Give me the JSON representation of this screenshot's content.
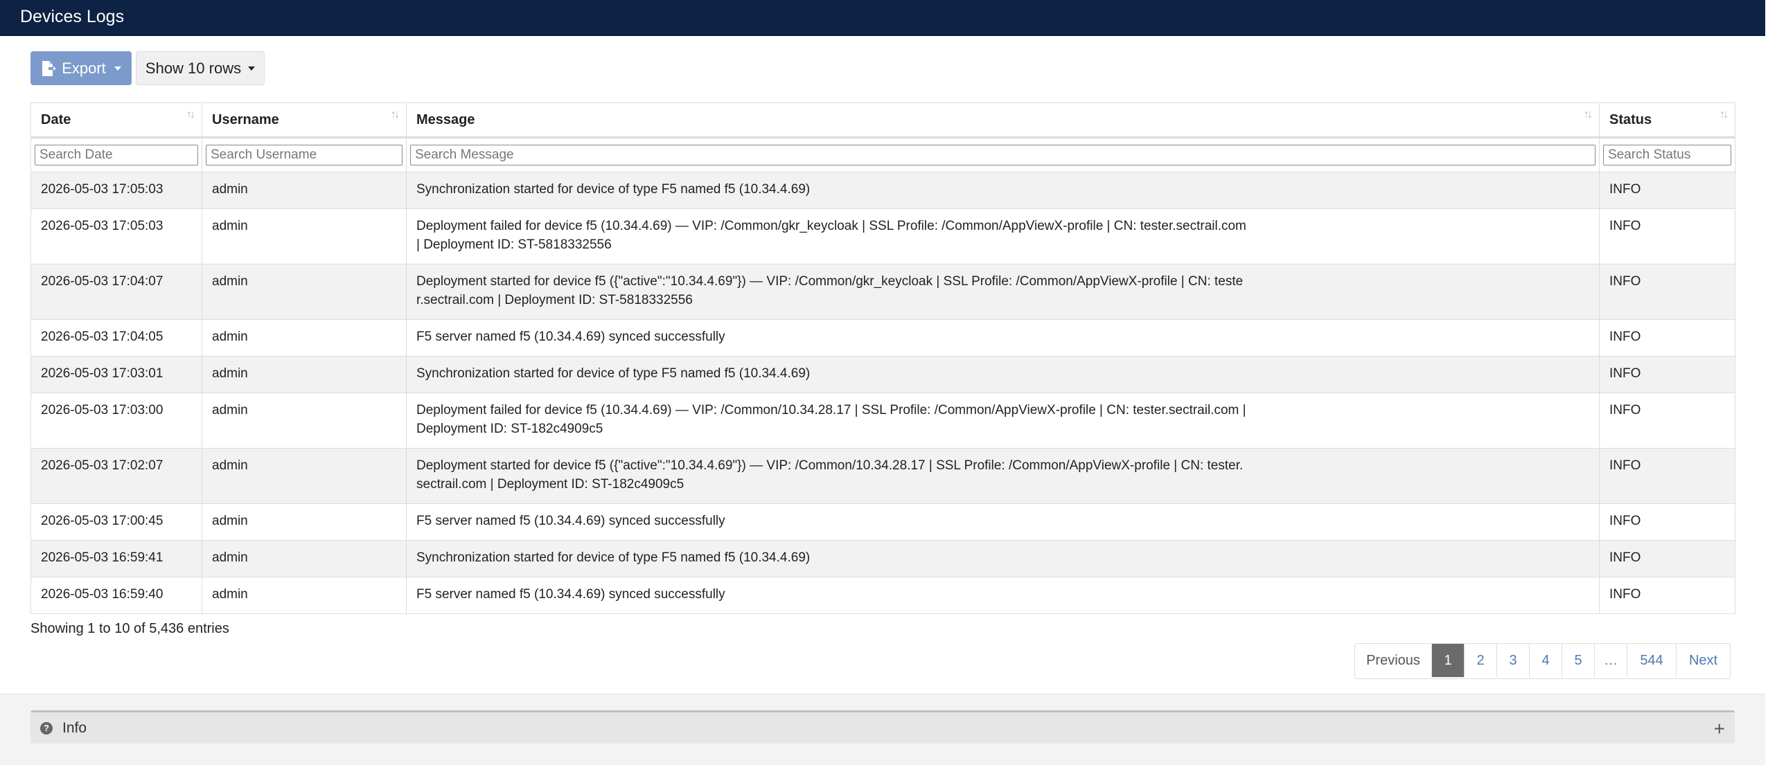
{
  "window": {
    "title": "Devices Logs"
  },
  "toolbar": {
    "export_label": "Export",
    "rows_label": "Show 10 rows"
  },
  "table": {
    "columns": [
      "Date",
      "Username",
      "Message",
      "Status"
    ],
    "filter_placeholders": [
      "Search Date",
      "Search Username",
      "Search Message",
      "Search Status"
    ],
    "rows": [
      {
        "date": "2026-05-03 17:05:03",
        "user": "admin",
        "message": "Synchronization started for device of type F5 named f5 (10.34.4.69)",
        "status": "INFO"
      },
      {
        "date": "2026-05-03 17:05:03",
        "user": "admin",
        "message": "Deployment failed for device f5 (10.34.4.69) — VIP: /Common/gkr_keycloak | SSL Profile: /Common/AppViewX-profile | CN: tester.sectrail.com | Deployment ID: ST-5818332556",
        "status": "INFO"
      },
      {
        "date": "2026-05-03 17:04:07",
        "user": "admin",
        "message": "Deployment started for device f5 ({\"active\":\"10.34.4.69\"}) — VIP: /Common/gkr_keycloak | SSL Profile: /Common/AppViewX-profile | CN: tester.sectrail.com | Deployment ID: ST-5818332556",
        "status": "INFO"
      },
      {
        "date": "2026-05-03 17:04:05",
        "user": "admin",
        "message": "F5 server named f5 (10.34.4.69) synced successfully",
        "status": "INFO"
      },
      {
        "date": "2026-05-03 17:03:01",
        "user": "admin",
        "message": "Synchronization started for device of type F5 named f5 (10.34.4.69)",
        "status": "INFO"
      },
      {
        "date": "2026-05-03 17:03:00",
        "user": "admin",
        "message": "Deployment failed for device f5 (10.34.4.69) — VIP: /Common/10.34.28.17 | SSL Profile: /Common/AppViewX-profile | CN: tester.sectrail.com | Deployment ID: ST-182c4909c5",
        "status": "INFO"
      },
      {
        "date": "2026-05-03 17:02:07",
        "user": "admin",
        "message": "Deployment started for device f5 ({\"active\":\"10.34.4.69\"}) — VIP: /Common/10.34.28.17 | SSL Profile: /Common/AppViewX-profile | CN: tester.sectrail.com | Deployment ID: ST-182c4909c5",
        "status": "INFO"
      },
      {
        "date": "2026-05-03 17:00:45",
        "user": "admin",
        "message": "F5 server named f5 (10.34.4.69) synced successfully",
        "status": "INFO"
      },
      {
        "date": "2026-05-03 16:59:41",
        "user": "admin",
        "message": "Synchronization started for device of type F5 named f5 (10.34.4.69)",
        "status": "INFO"
      },
      {
        "date": "2026-05-03 16:59:40",
        "user": "admin",
        "message": "F5 server named f5 (10.34.4.69) synced successfully",
        "status": "INFO"
      }
    ]
  },
  "summary": "Showing 1 to 10 of 5,436 entries",
  "pagination": {
    "previous": "Previous",
    "pages": [
      "1",
      "2",
      "3",
      "4",
      "5",
      "…",
      "544"
    ],
    "active_page": "1",
    "next": "Next"
  },
  "info_panel": {
    "label": "Info",
    "expand_icon": "plus-icon"
  },
  "icons": {
    "export": "file-export-icon",
    "sort": "sort-icon",
    "info": "question-circle-icon"
  },
  "colors": {
    "titlebar": "#0d2244",
    "export_button": "#7c9bcc",
    "active_page": "#6b6b6b",
    "link": "#4f7ab0"
  }
}
